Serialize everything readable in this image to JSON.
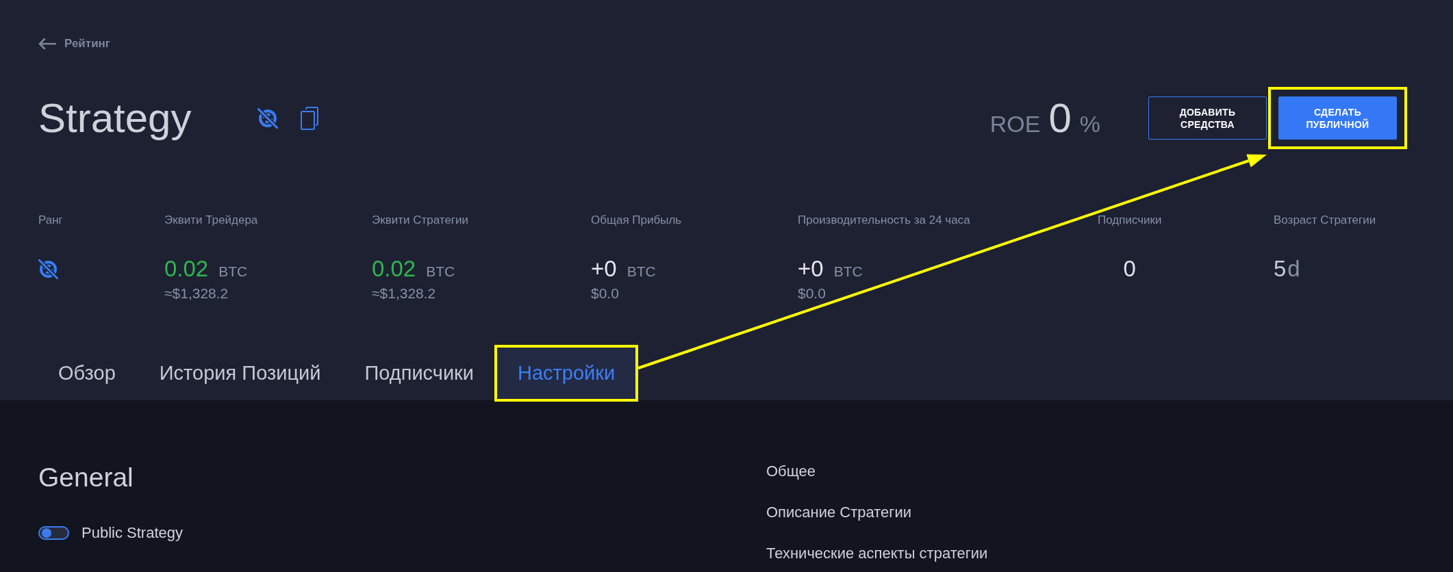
{
  "back_link": {
    "label": "Рейтинг"
  },
  "header": {
    "title": "Strategy",
    "roe": {
      "label": "ROE",
      "value": "0",
      "unit": "%"
    },
    "buttons": [
      {
        "label": "ДОБАВИТЬ СРЕДСТВА",
        "kind": "outline",
        "highlighted": false
      },
      {
        "label": "СДЕЛАТЬ ПУБЛИЧНОЙ",
        "kind": "primary",
        "highlighted": true
      }
    ]
  },
  "stats": [
    {
      "label": "Ранг",
      "kind": "icon"
    },
    {
      "label": "Эквити Трейдера",
      "kind": "amount",
      "value": "0.02",
      "unit": "BTC",
      "sub": "≈$1,328.2",
      "color": "#2db84d"
    },
    {
      "label": "Эквити Стратегии",
      "kind": "amount",
      "value": "0.02",
      "unit": "BTC",
      "sub": "≈$1,328.2",
      "color": "#2db84d"
    },
    {
      "label": "Общая Прибыль",
      "kind": "amount",
      "value": "+0",
      "unit": "BTC",
      "sub": "$0.0",
      "color": "#e4e7ee"
    },
    {
      "label": "Производительность за 24 часа",
      "kind": "amount",
      "value": "+0",
      "unit": "BTC",
      "sub": "$0.0",
      "color": "#e4e7ee"
    },
    {
      "label": "Подписчики",
      "kind": "count",
      "value": "0"
    },
    {
      "label": "Возраст Стратегии",
      "kind": "duration",
      "value": "5",
      "unit": "d"
    }
  ],
  "tabs": [
    {
      "label": "Обзор",
      "selected": false,
      "highlighted": false
    },
    {
      "label": "История Позиций",
      "selected": false,
      "highlighted": false
    },
    {
      "label": "Подписчики",
      "selected": false,
      "highlighted": false
    },
    {
      "label": "Настройки",
      "selected": true,
      "highlighted": true
    }
  ],
  "settings": {
    "title": "General",
    "toggles": [
      {
        "label": "Public Strategy",
        "on": false
      }
    ]
  },
  "section_links": [
    "Общее",
    "Описание Стратегии",
    "Технические аспекты стратегии"
  ]
}
